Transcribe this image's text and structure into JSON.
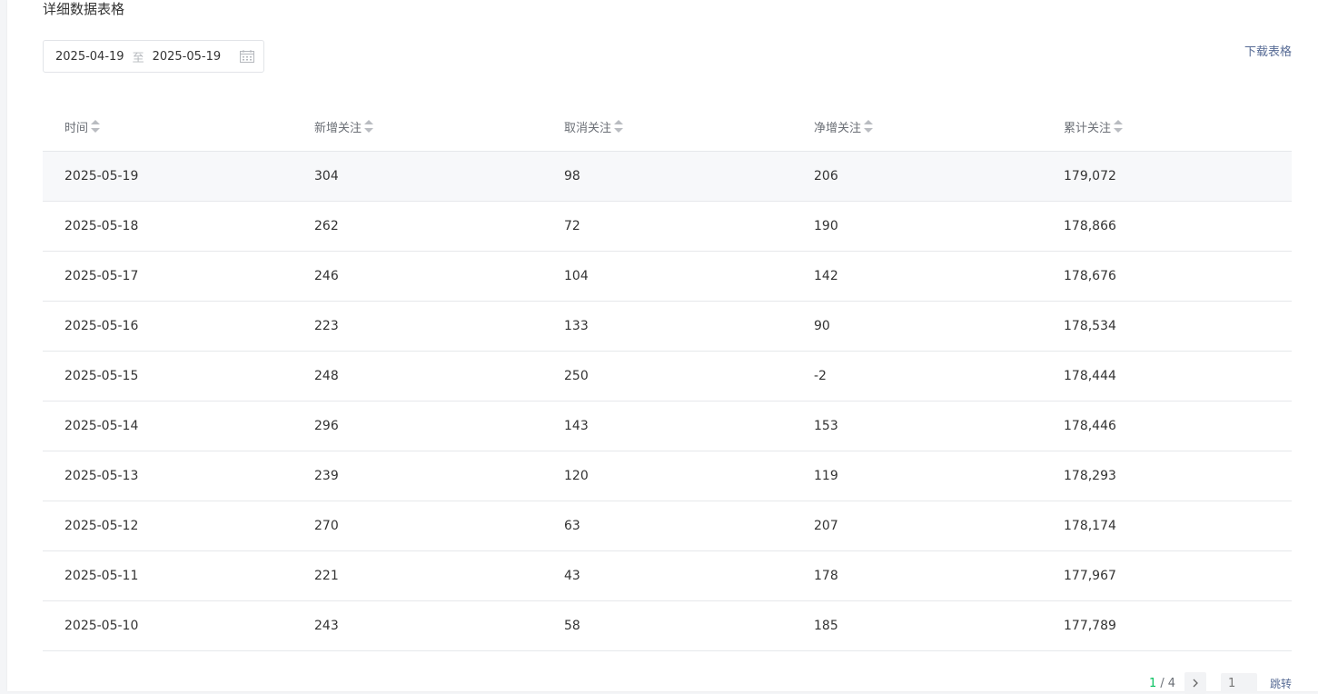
{
  "section": {
    "title": "详细数据表格",
    "download_label": "下载表格"
  },
  "date_range": {
    "start": "2025-04-19",
    "separator": "至",
    "end": "2025-05-19",
    "icon": "calendar-icon"
  },
  "table": {
    "headers": [
      "时间",
      "新增关注",
      "取消关注",
      "净增关注",
      "累计关注"
    ],
    "sort_icon": "sort-icon",
    "rows": [
      [
        "2025-05-19",
        "304",
        "98",
        "206",
        "179,072"
      ],
      [
        "2025-05-18",
        "262",
        "72",
        "190",
        "178,866"
      ],
      [
        "2025-05-17",
        "246",
        "104",
        "142",
        "178,676"
      ],
      [
        "2025-05-16",
        "223",
        "133",
        "90",
        "178,534"
      ],
      [
        "2025-05-15",
        "248",
        "250",
        "-2",
        "178,444"
      ],
      [
        "2025-05-14",
        "296",
        "143",
        "153",
        "178,446"
      ],
      [
        "2025-05-13",
        "239",
        "120",
        "119",
        "178,293"
      ],
      [
        "2025-05-12",
        "270",
        "63",
        "207",
        "178,174"
      ],
      [
        "2025-05-11",
        "221",
        "43",
        "178",
        "177,967"
      ],
      [
        "2025-05-10",
        "243",
        "58",
        "185",
        "177,789"
      ]
    ]
  },
  "pager": {
    "current": "1",
    "slash": "/",
    "total": "4",
    "next_icon": "chevron-right-icon",
    "goto_placeholder": "1",
    "jump_label": "跳转"
  },
  "colors": {
    "accent_green": "#07c160",
    "link_blue": "#576b95"
  }
}
